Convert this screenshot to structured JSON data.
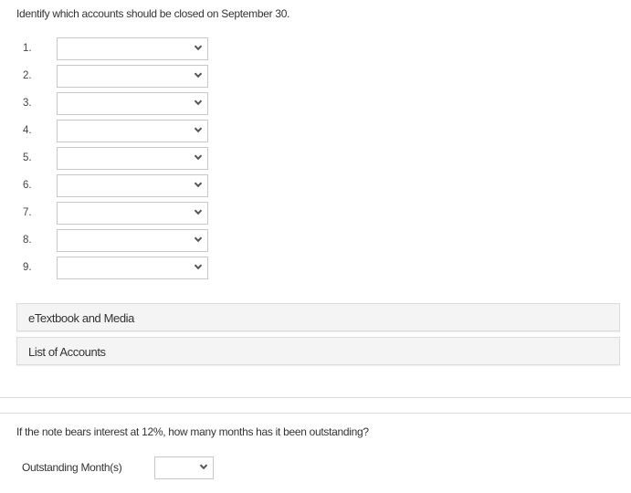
{
  "question1": {
    "instruction": "Identify which accounts should be closed on September 30.",
    "rows": [
      {
        "number": "1.",
        "selected": ""
      },
      {
        "number": "2.",
        "selected": ""
      },
      {
        "number": "3.",
        "selected": ""
      },
      {
        "number": "4.",
        "selected": ""
      },
      {
        "number": "5.",
        "selected": ""
      },
      {
        "number": "6.",
        "selected": ""
      },
      {
        "number": "7.",
        "selected": ""
      },
      {
        "number": "8.",
        "selected": ""
      },
      {
        "number": "9.",
        "selected": ""
      }
    ]
  },
  "panels": {
    "etextbook": "eTextbook and Media",
    "list_of_accounts": "List of Accounts"
  },
  "question2": {
    "prompt": "If the note bears interest at 12%, how many months has it been outstanding?",
    "field_label": "Outstanding Month(s)",
    "selected": ""
  },
  "icons": {
    "dropdown": "chevron-down-icon"
  },
  "colors": {
    "panel_bg": "#f4f4f4",
    "border": "#c8c8c8",
    "text": "#333333"
  }
}
